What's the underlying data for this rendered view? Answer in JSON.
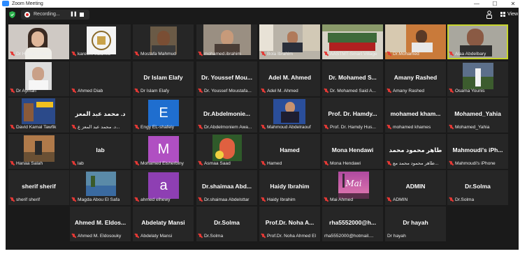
{
  "window": {
    "title": "Zoom Meeting",
    "minimize": "—",
    "maximize": "☐",
    "close": "✕"
  },
  "toolbar": {
    "recording_label": "Recording...",
    "pause_symbol": "❚❚",
    "view_label": "View"
  },
  "colors": {
    "active_speaker_border": "#c7d42b",
    "muted_mic": "#e53935",
    "tile_bg": "#262626",
    "window_bg": "#1a1a1a"
  },
  "tiles": [
    {
      "name": "Dr Hanan Gouda"
    },
    {
      "name": "kareem elzahed"
    },
    {
      "name": "Mostafa Mahmud"
    },
    {
      "name": "mohamed.ibrahim"
    },
    {
      "name": "Bola Ibrahim"
    },
    {
      "name": "AASTMT-Smart Village"
    },
    {
      "name": "Dr.Mohamed"
    },
    {
      "name": "Alaa Abdelbary"
    },
    {
      "name": "Dr Ayman"
    },
    {
      "name": "Ahmed Diab"
    },
    {
      "center": "Dr Islam Elafy",
      "name": "Dr Islam Elafy"
    },
    {
      "center": "Dr. Youssef Mou...",
      "name": "Dr. Youssef Moustafa..."
    },
    {
      "center": "Adel M. Ahmed",
      "name": "Adel M. Ahmed"
    },
    {
      "center": "Dr. Mohamed S...",
      "name": "Dr. Mohamed Said A..."
    },
    {
      "center": "Amany Rashed",
      "name": "Amany Rashed"
    },
    {
      "name": "Osama Younis"
    },
    {
      "name": "David Kamal Tawfik"
    },
    {
      "center": "د. محمد عبد المعز",
      "name": "د. محمد عبد المعز ع..."
    },
    {
      "letter": "E",
      "name": "Engy EL-shafeiy"
    },
    {
      "center": "Dr.Abdelmonie...",
      "name": "Dr.Abdelmoniem Awa..."
    },
    {
      "name": "Mahmoud Abdelraouf"
    },
    {
      "center": "Prof. Dr. Hamdy...",
      "name": "Prof. Dr. Hamdy Hus..."
    },
    {
      "center": "mohamed kham...",
      "name": "mohamed khames"
    },
    {
      "center": "Mohamed_Yahia",
      "name": "Mohamed_Yahia"
    },
    {
      "name": "Hanaa Salah"
    },
    {
      "center": "lab",
      "name": "lab"
    },
    {
      "letter": "M",
      "name": "Mohamed Elsherbiny"
    },
    {
      "name": "Asmaa Saad"
    },
    {
      "center": "Hamed",
      "name": "Hamed"
    },
    {
      "center": "Mona Hendawi",
      "name": "Mona Hendawi"
    },
    {
      "center": "طاهر محمود محمد",
      "name": "طاهر محمود محمد مع..."
    },
    {
      "center": "Mahmoudi's iPh...",
      "name": "Mahmoudi's iPhone"
    },
    {
      "center": "sherif sherif",
      "name": "sherif sherif"
    },
    {
      "name": "Magda Abou El Safa"
    },
    {
      "letter": "a",
      "name": "ahmed elhewy"
    },
    {
      "center": "Dr.shaimaa Abd...",
      "name": "Dr.shaimaa Abdelsttar"
    },
    {
      "center": "Haidy Ibrahim",
      "name": "Haidy Ibrahim"
    },
    {
      "name": "Mai Ahmed",
      "caption": "Mai"
    },
    {
      "center": "ADMIN",
      "name": "ADMIN"
    },
    {
      "center": "Dr.Solma",
      "name": "Dr.Solma"
    },
    {
      "center": "Ahmed M. Eldos...",
      "name": "Ahmed M. Eldosouky"
    },
    {
      "center": "Abdelaty Mansi",
      "name": "Abdelaty Mansi"
    },
    {
      "center": "Dr.Solma",
      "name": "Dr.Solma"
    },
    {
      "center": "Prof.Dr. Noha A...",
      "name": "Prof.Dr. Noha Ahmed El ..."
    },
    {
      "center": "rha5552000@h...",
      "name": "rha5552000@hotmail...."
    },
    {
      "center": "Dr hayah",
      "name": "Dr hayah"
    }
  ]
}
